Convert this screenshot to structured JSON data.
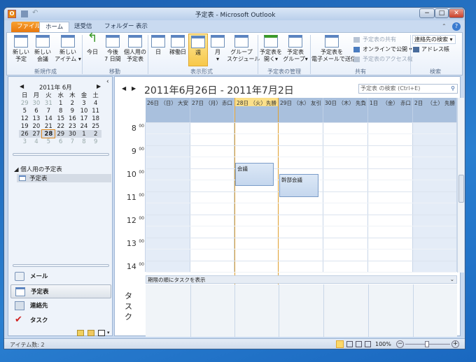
{
  "window": {
    "title": "予定表 - Microsoft Outlook",
    "minimize": "−",
    "maximize": "□",
    "close": "✕",
    "help": "?"
  },
  "tabs": [
    "ファイル",
    "ホーム",
    "送受信",
    "フォルダー",
    "表示"
  ],
  "ribbon": {
    "groups": [
      {
        "label": "新規作成",
        "buttons": [
          "新しい\n予定",
          "新しい\n会議",
          "新しい\nアイテム ▾"
        ]
      },
      {
        "label": "移動",
        "buttons": [
          "今日",
          "今後\n7 日間",
          "個人用の\n予定表"
        ]
      },
      {
        "label": "表示形式",
        "buttons": [
          "日",
          "稼働日",
          "週",
          "月\n▾",
          "グループ\nスケジュール"
        ]
      },
      {
        "label": "予定表の管理",
        "buttons": [
          "予定表を\n開く▾",
          "予定表\nグループ▾"
        ]
      },
      {
        "label": "共有",
        "buttons": [
          "予定表を\n電子メールで送信"
        ],
        "small": [
          "予定表の共有",
          "オンラインで公開 ▾",
          "予定表のアクセス権"
        ]
      },
      {
        "label": "検索",
        "small": [
          "連絡先の検索 ▾",
          "アドレス帳"
        ]
      }
    ]
  },
  "mini_calendar": {
    "title": "2011年 6月",
    "weekdays": [
      "日",
      "月",
      "火",
      "水",
      "木",
      "金",
      "土"
    ],
    "weeks": [
      [
        "29",
        "30",
        "31",
        "1",
        "2",
        "3",
        "4"
      ],
      [
        "5",
        "6",
        "7",
        "8",
        "9",
        "10",
        "11"
      ],
      [
        "12",
        "13",
        "14",
        "15",
        "16",
        "17",
        "18"
      ],
      [
        "19",
        "20",
        "21",
        "22",
        "23",
        "24",
        "25"
      ],
      [
        "26",
        "27",
        "28",
        "29",
        "30",
        "1",
        "2"
      ],
      [
        "3",
        "4",
        "5",
        "6",
        "7",
        "8",
        "9"
      ]
    ],
    "today": "28"
  },
  "folders": {
    "group": "個人用の予定表",
    "items": [
      "予定表"
    ]
  },
  "nav_buttons": [
    "メール",
    "予定表",
    "連絡先",
    "タスク"
  ],
  "calendar": {
    "range_title": "2011年6月26日 - 2011年7月2日",
    "search_placeholder": "予定表 の検索 (Ctrl+E)",
    "days": [
      {
        "date": "26日 （日）",
        "rokuyo": "大安"
      },
      {
        "date": "27日 （月）",
        "rokuyo": "赤口"
      },
      {
        "date": "28日 （火）",
        "rokuyo": "先勝",
        "today": true
      },
      {
        "date": "29日 （水）",
        "rokuyo": "友引"
      },
      {
        "date": "30日 （木）",
        "rokuyo": "先負"
      },
      {
        "date": "1日 　（金）",
        "rokuyo": "赤口"
      },
      {
        "date": "2日 　（土）",
        "rokuyo": "先勝"
      }
    ],
    "hours": [
      "8",
      "9",
      "10",
      "11",
      "12",
      "13",
      "14"
    ],
    "minutes": "00",
    "events": [
      {
        "title": "会議",
        "day": "28日",
        "start": "9:30",
        "end": "10:30"
      },
      {
        "title": "幹部会議",
        "day": "29日",
        "start": "10:00",
        "end": "11:00"
      }
    ],
    "task_bar": "期限の順にタスクを表示",
    "task_label": "タスク"
  },
  "status": {
    "items": "アイテム数: 2",
    "zoom": "100%"
  },
  "colors": {
    "accent": "#f0a030",
    "header": "#a9c0dd",
    "file_tab": "#e9780d"
  }
}
